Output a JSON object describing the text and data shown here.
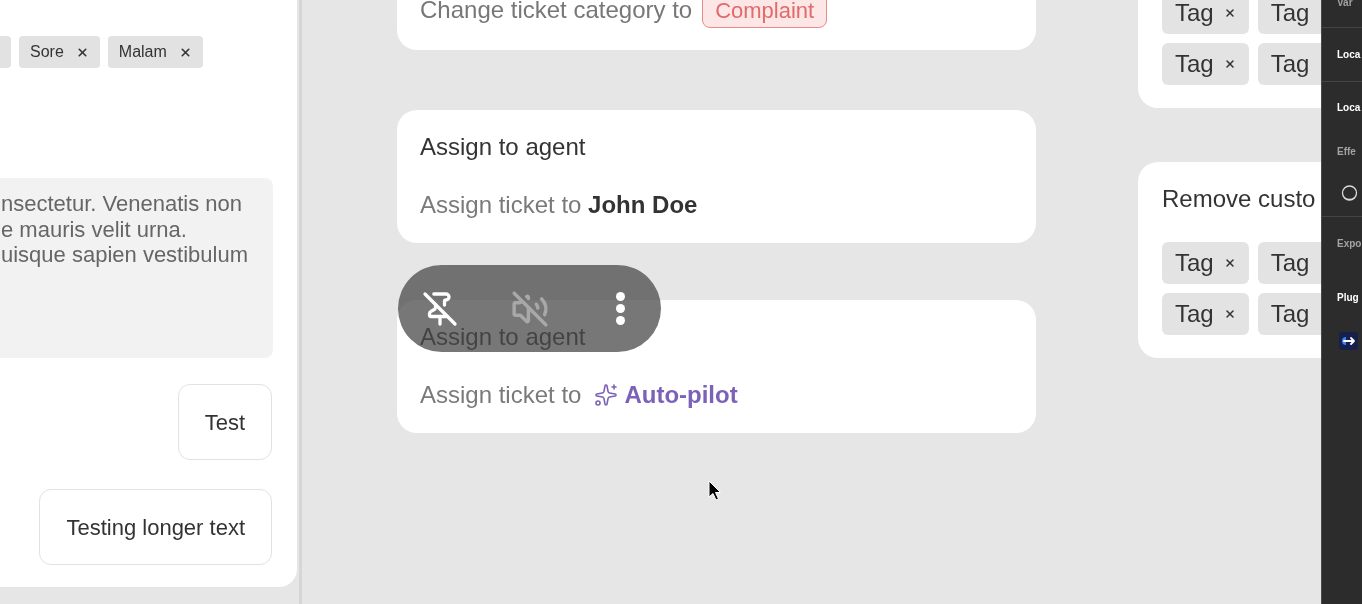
{
  "left_panel": {
    "tags": [
      {
        "label": "Sore"
      },
      {
        "label": "Malam"
      }
    ],
    "text_area": {
      "value": "nsectetur. Venenatis non\ne mauris velit urna.\nuisque sapien vestibulum"
    },
    "buttons": [
      "Test",
      "Testing longer text"
    ]
  },
  "actions": [
    {
      "kind": "category",
      "text": "Change ticket category to",
      "badge": "Complaint"
    },
    {
      "kind": "agent",
      "title": "Assign to agent",
      "text": "Assign ticket to **John Doe**"
    },
    {
      "kind": "autopilot",
      "title": "Assign to agent",
      "text": "Assign ticket to",
      "assignee": "Auto-pilot"
    }
  ],
  "video_overlay": {
    "controls": [
      {
        "kind": "pin",
        "disabled": false
      },
      {
        "kind": "mute",
        "disabled": true
      },
      {
        "kind": "more",
        "disabled": false
      }
    ]
  },
  "tag_cards": [
    {
      "tag_rows": [
        [
          {
            "label": "Tag",
            "close_icon": true
          },
          {
            "label": "Tag",
            "close_icon": false
          }
        ],
        [
          {
            "label": "Tag",
            "close_icon": true
          },
          {
            "label": "Tag",
            "close_icon": false
          }
        ]
      ]
    },
    {
      "title": "Remove custo",
      "tag_rows": [
        [
          {
            "label": "Tag",
            "close_icon": true
          },
          {
            "label": "Tag",
            "close_icon": false
          }
        ],
        [
          {
            "label": "Tag",
            "close_icon": true
          },
          {
            "label": "Tag",
            "close_icon": false
          }
        ]
      ]
    }
  ],
  "side_panel": {
    "sections": [
      {
        "items": [
          {
            "kind": "label",
            "text": "Var"
          }
        ]
      },
      {
        "items": [
          {
            "kind": "heading",
            "text": "Loca"
          }
        ]
      },
      {
        "items": [
          {
            "kind": "heading",
            "text": "Loca"
          },
          {
            "kind": "label",
            "text": "Effe"
          },
          {
            "kind": "ring"
          }
        ]
      },
      {
        "items": [
          {
            "kind": "label",
            "text": "Expo"
          },
          {
            "kind": "heading",
            "text": "Plug"
          },
          {
            "kind": "plugin"
          }
        ]
      }
    ]
  }
}
